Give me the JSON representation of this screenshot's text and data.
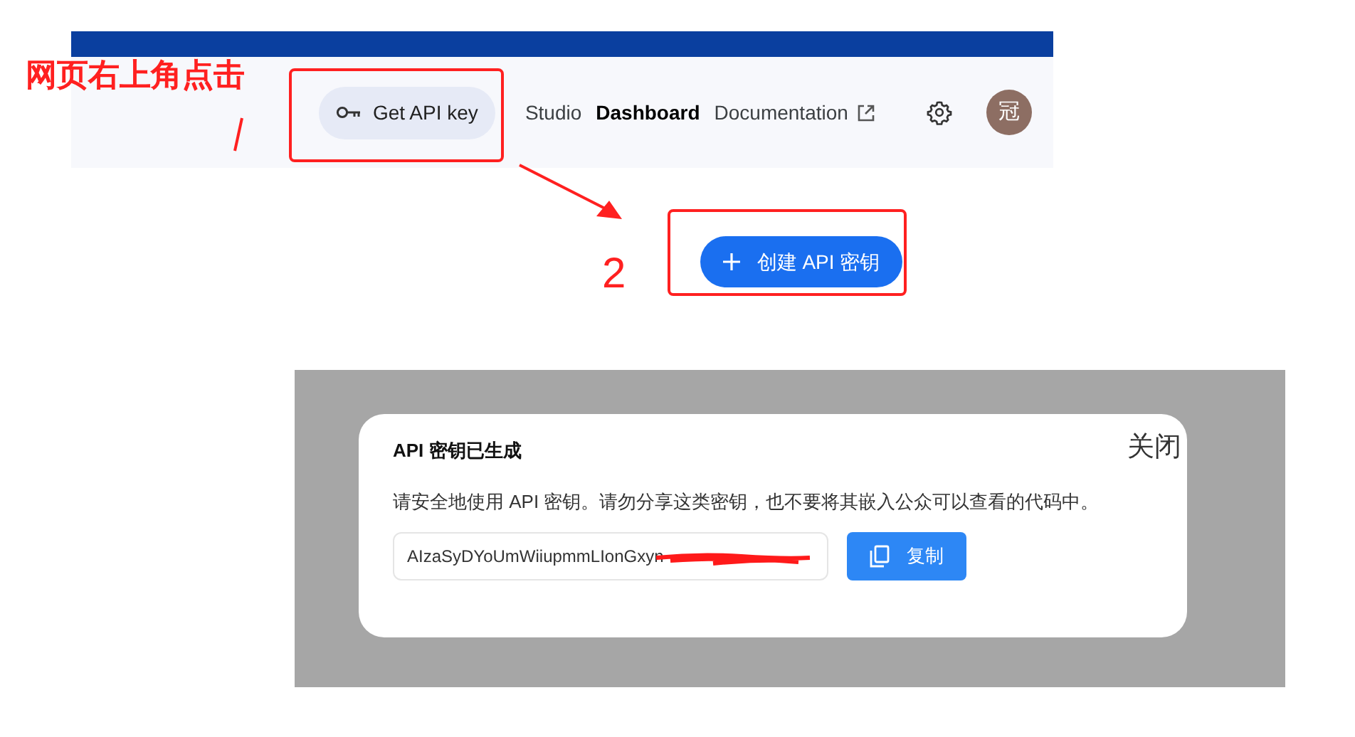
{
  "annotations": [
    {
      "kind": "label",
      "text": "网页右上角点击"
    },
    {
      "kind": "step",
      "text": "2"
    }
  ],
  "header": {
    "get_api_key": "Get API key",
    "nav": [
      {
        "label": "Studio",
        "selected": false,
        "external": false
      },
      {
        "label": "Dashboard",
        "selected": true,
        "external": false
      },
      {
        "label": "Documentation",
        "selected": false,
        "external": true
      }
    ],
    "avatar": "冠"
  },
  "create_button": "创建 API 密钥",
  "dialog": {
    "title": "API 密钥已生成",
    "close": "关闭",
    "message": "请安全地使用 API 密钥。请勿分享这类密钥，也不要将其嵌入公众可以查看的代码中。",
    "key_value": "AIzaSyDYoUmWiiupmmLIonGxyn",
    "copy_button": "复制"
  }
}
